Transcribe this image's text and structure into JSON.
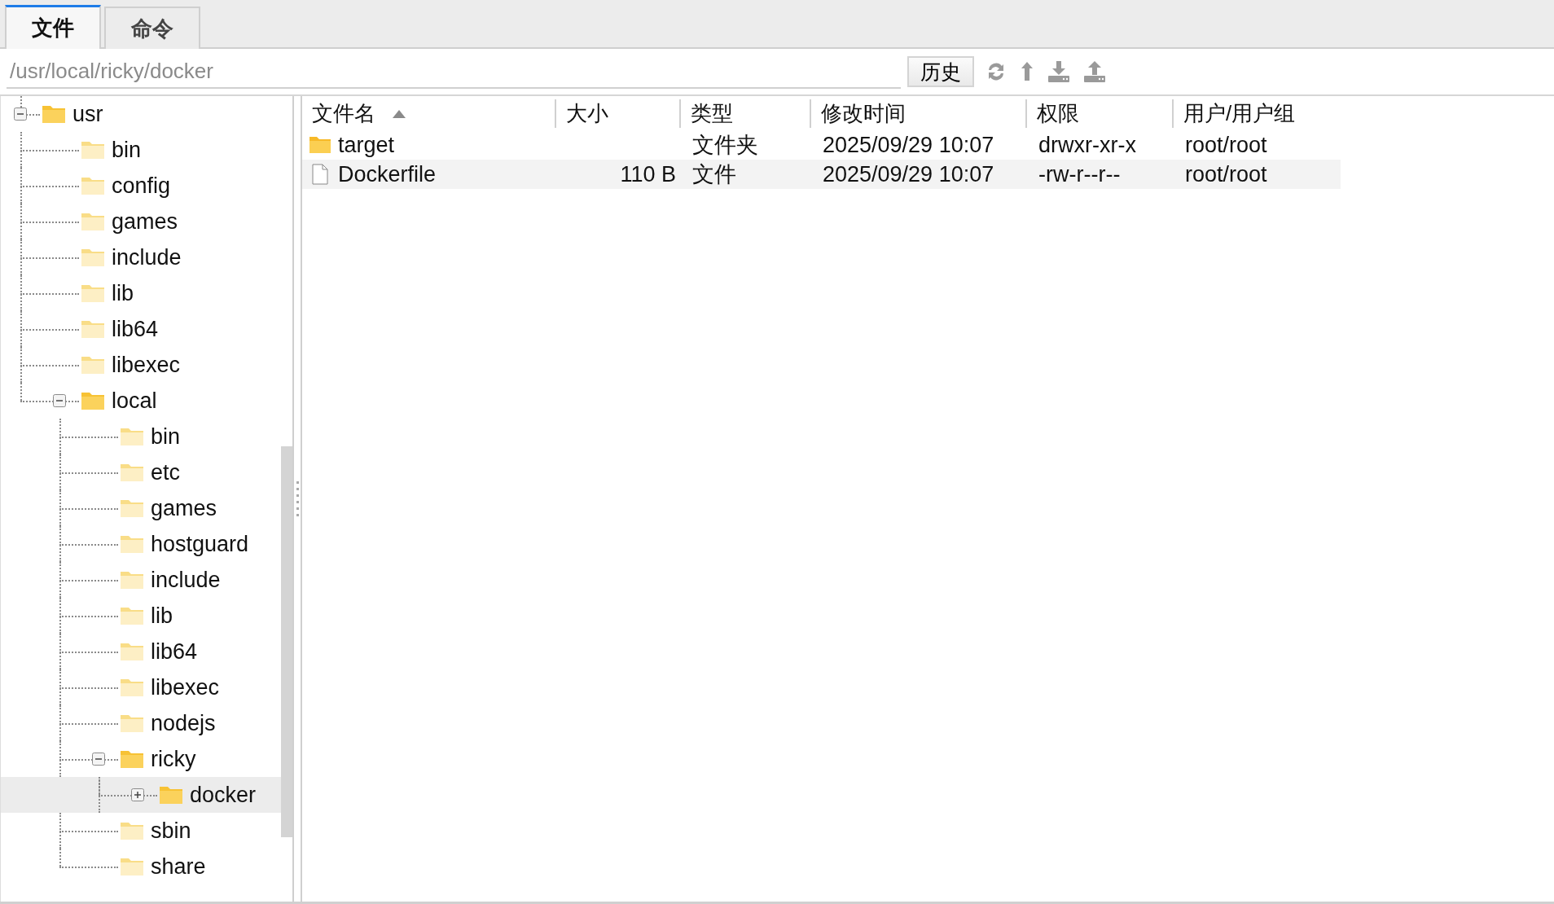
{
  "tabs": [
    {
      "label": "文件",
      "selected": true
    },
    {
      "label": "命令",
      "selected": false
    }
  ],
  "path_bar": {
    "value": "/usr/local/ricky/docker",
    "history_button": "历史"
  },
  "tree": [
    {
      "label": "usr",
      "expanded": true,
      "selected": false,
      "children": [
        {
          "label": "bin",
          "selected": false
        },
        {
          "label": "config",
          "selected": false
        },
        {
          "label": "games",
          "selected": false
        },
        {
          "label": "include",
          "selected": false
        },
        {
          "label": "lib",
          "selected": false
        },
        {
          "label": "lib64",
          "selected": false
        },
        {
          "label": "libexec",
          "selected": false
        },
        {
          "label": "local",
          "expanded": true,
          "selected": false,
          "children": [
            {
              "label": "bin",
              "selected": false
            },
            {
              "label": "etc",
              "selected": false
            },
            {
              "label": "games",
              "selected": false
            },
            {
              "label": "hostguard",
              "selected": false
            },
            {
              "label": "include",
              "selected": false
            },
            {
              "label": "lib",
              "selected": false
            },
            {
              "label": "lib64",
              "selected": false
            },
            {
              "label": "libexec",
              "selected": false
            },
            {
              "label": "nodejs",
              "selected": false
            },
            {
              "label": "ricky",
              "expanded": true,
              "selected": false,
              "children": [
                {
                  "label": "docker",
                  "expanded": false,
                  "selected": true
                }
              ]
            },
            {
              "label": "sbin",
              "selected": false
            },
            {
              "label": "share",
              "selected": false
            }
          ]
        }
      ]
    }
  ],
  "table": {
    "columns": [
      {
        "label": "文件名",
        "sorted": true
      },
      {
        "label": "大小",
        "sorted": false
      },
      {
        "label": "类型",
        "sorted": false
      },
      {
        "label": "修改时间",
        "sorted": false
      },
      {
        "label": "权限",
        "sorted": false
      },
      {
        "label": "用户/用户组",
        "sorted": false
      }
    ],
    "rows": [
      {
        "kind": "folder",
        "selected": false,
        "name": "target",
        "type": "文件夹",
        "modified": "2025/09/29 10:07",
        "permissions": "drwxr-xr-x",
        "owner": "root/root"
      },
      {
        "kind": "file",
        "selected": true,
        "name": "Dockerfile",
        "size": "110 B",
        "type": "文件",
        "modified": "2025/09/29 10:07",
        "permissions": "-rw-r--r--",
        "owner": "root/root"
      }
    ]
  }
}
